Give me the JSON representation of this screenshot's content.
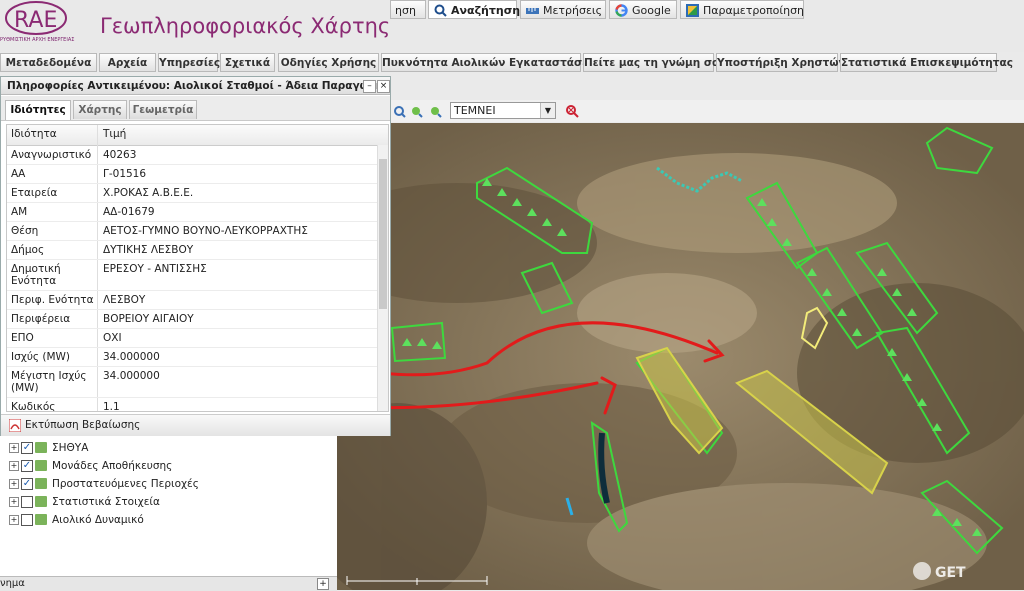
{
  "header": {
    "logo_text": "RAE",
    "logo_subtitle": "ΡΥΘΜΙΣΤΙΚΗ ΑΡΧΗ ΕΝΕΡΓΕΙΑΣ",
    "title": "Γεωπληροφοριακός Χάρτης"
  },
  "nav": {
    "tabs": [
      "Μεταδεδομένα",
      "Αρχεία",
      "Υπηρεσίες",
      "Σχετικά",
      "Οδηγίες Χρήσης",
      "Πυκνότητα Αιολικών Εγκαταστάσεων",
      "Πείτε μας τη γνώμη σας",
      "Υποστήριξη Χρηστών",
      "Στατιστικά Επισκεψιμότητας"
    ]
  },
  "toolbar": {
    "partial_label": "ηση",
    "search_label": "Αναζήτηση",
    "measure_label": "Μετρήσεις",
    "google_label": "Google",
    "params_label": "Παραμετροποίηση",
    "select_value": "ΤΕΜΝΕΙ"
  },
  "panel": {
    "title": "Πληροφορίες Αντικειμένου: Αιολικοί Σταθμοί - Άδεια Παραγωγής",
    "tabs": [
      "Ιδιότητες",
      "Χάρτης",
      "Γεωμετρία"
    ],
    "col_property": "Ιδιότητα",
    "col_value": "Τιμή",
    "rows": [
      {
        "k": "Αναγνωριστικό",
        "v": "40263"
      },
      {
        "k": "ΑΑ",
        "v": "Γ-01516"
      },
      {
        "k": "Εταιρεία",
        "v": "Χ.ΡΟΚΑΣ Α.Β.Ε.Ε."
      },
      {
        "k": "ΑΜ",
        "v": "ΑΔ-01679"
      },
      {
        "k": "Θέση",
        "v": "ΑΕΤΟΣ-ΓΥΜΝΟ ΒΟΥΝΟ-ΛΕΥΚΟΡΡΑΧΤΗΣ"
      },
      {
        "k": "Δήμος",
        "v": "ΔΥΤΙΚΗΣ ΛΕΣΒΟΥ"
      },
      {
        "k": "Δημοτική Ενότητα",
        "v": "ΕΡΕΣΟΥ - ΑΝΤΙΣΣΗΣ"
      },
      {
        "k": "Περιφ. Ενότητα",
        "v": "ΛΕΣΒΟΥ"
      },
      {
        "k": "Περιφέρεια",
        "v": "ΒΟΡΕΙΟΥ ΑΙΓΑΙΟΥ"
      },
      {
        "k": "ΕΠΟ",
        "v": "ΟΧΙ"
      },
      {
        "k": "Ισχύς (MW)",
        "v": "34.000000"
      },
      {
        "k": "Μέγιστη Ισχύς (MW)",
        "v": "34.000000"
      },
      {
        "k": "Κωδικός",
        "v": "1.1"
      }
    ],
    "print_label": "Εκτύπωση Βεβαίωσης"
  },
  "layers": {
    "items": [
      {
        "label": "ΣΗΘΥΑ",
        "checked": true
      },
      {
        "label": "Μονάδες Αποθήκευσης",
        "checked": true
      },
      {
        "label": "Προστατευόμενες Περιοχές",
        "checked": true
      },
      {
        "label": "Στατιστικά Στοιχεία",
        "checked": false
      },
      {
        "label": "Αιολικό Δυναμικό",
        "checked": false
      }
    ],
    "checkmark": "✓"
  },
  "bottom": {
    "label": "νημα"
  },
  "map": {
    "watermark": "GET"
  }
}
